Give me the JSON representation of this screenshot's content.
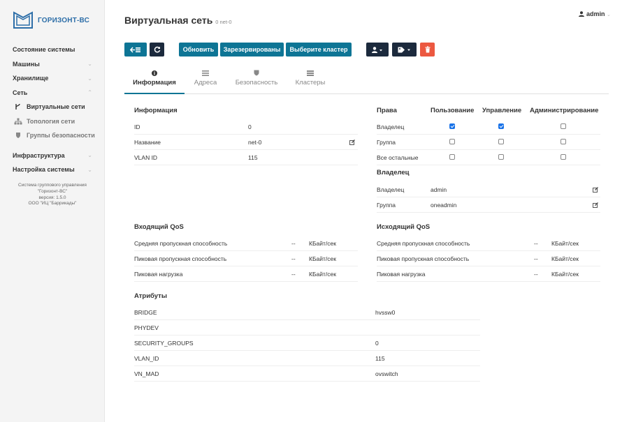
{
  "app": {
    "name": "ГОРИЗОНТ-ВС",
    "version_info": [
      "Система группового управления",
      "\"Горизонт-ВС\"",
      "версия: 1.5.0",
      "ООО \"ИЦ \"Баррикады\""
    ]
  },
  "sidebar": {
    "items": [
      {
        "label": "Состояние системы"
      },
      {
        "label": "Машины",
        "chevron": "⌄"
      },
      {
        "label": "Хранилище",
        "chevron": "⌄"
      },
      {
        "label": "Сеть",
        "chevron": "⌃"
      }
    ],
    "sub_items": [
      {
        "label": "Виртуальные сети",
        "icon": "network-icon"
      },
      {
        "label": "Топология сети",
        "icon": "sitemap-icon"
      },
      {
        "label": "Группы безопасности",
        "icon": "shield-icon"
      }
    ],
    "items2": [
      {
        "label": "Инфраструктура",
        "chevron": "⌄"
      },
      {
        "label": "Настройка системы",
        "chevron": "⌄"
      }
    ]
  },
  "header": {
    "title": "Виртуальная сеть",
    "subtitle": "0 net-0",
    "user": "admin",
    "user_caret": "⌄"
  },
  "toolbar": {
    "refresh_label": "Обновить",
    "reserved_label": "Зарезервированы",
    "cluster_label": "Выберите кластер"
  },
  "tabs": [
    {
      "label": "Информация",
      "icon": "info-icon",
      "active": true
    },
    {
      "label": "Адреса",
      "icon": "list-icon",
      "active": false
    },
    {
      "label": "Безопасность",
      "icon": "shield-icon",
      "active": false
    },
    {
      "label": "Кластеры",
      "icon": "server-icon",
      "active": false
    }
  ],
  "info": {
    "title": "Информация",
    "rows": [
      {
        "key": "ID",
        "value": "0"
      },
      {
        "key": "Название",
        "value": "net-0"
      },
      {
        "key": "VLAN ID",
        "value": "115"
      }
    ]
  },
  "rights": {
    "title": "Права",
    "columns": [
      "Пользование",
      "Управление",
      "Администрирование"
    ],
    "rows": [
      {
        "label": "Владелец",
        "use": true,
        "manage": true,
        "admin": false
      },
      {
        "label": "Группа",
        "use": false,
        "manage": false,
        "admin": false
      },
      {
        "label": "Все остальные",
        "use": false,
        "manage": false,
        "admin": false
      }
    ]
  },
  "owner": {
    "title": "Владелец",
    "rows": [
      {
        "key": "Владелец",
        "value": "admin"
      },
      {
        "key": "Группа",
        "value": "oneadmin"
      }
    ]
  },
  "qos_in": {
    "title": "Входящий QoS",
    "rows": [
      {
        "key": "Средняя пропускная способность",
        "value": "--",
        "unit": "КБайт/сек"
      },
      {
        "key": "Пиковая пропускная способность",
        "value": "--",
        "unit": "КБайт/сек"
      },
      {
        "key": "Пиковая нагрузка",
        "value": "--",
        "unit": "КБайт/сек"
      }
    ]
  },
  "qos_out": {
    "title": "Исходящий QoS",
    "rows": [
      {
        "key": "Средняя пропускная способность",
        "value": "--",
        "unit": "КБайт/сек"
      },
      {
        "key": "Пиковая пропускная способность",
        "value": "--",
        "unit": "КБайт/сек"
      },
      {
        "key": "Пиковая нагрузка",
        "value": "--",
        "unit": "КБайт/сек"
      }
    ]
  },
  "attributes": {
    "title": "Атрибуты",
    "rows": [
      {
        "key": "BRIDGE",
        "value": "hvssw0"
      },
      {
        "key": "PHYDEV",
        "value": ""
      },
      {
        "key": "SECURITY_GROUPS",
        "value": "0"
      },
      {
        "key": "VLAN_ID",
        "value": "115"
      },
      {
        "key": "VN_MAD",
        "value": "ovswitch"
      }
    ]
  },
  "colors": {
    "accent": "#0e7595",
    "dark_button": "#1c2a3d",
    "danger": "#ec5840",
    "logo": "#2d6ea8",
    "checkbox_checked": "#1a73e8"
  }
}
